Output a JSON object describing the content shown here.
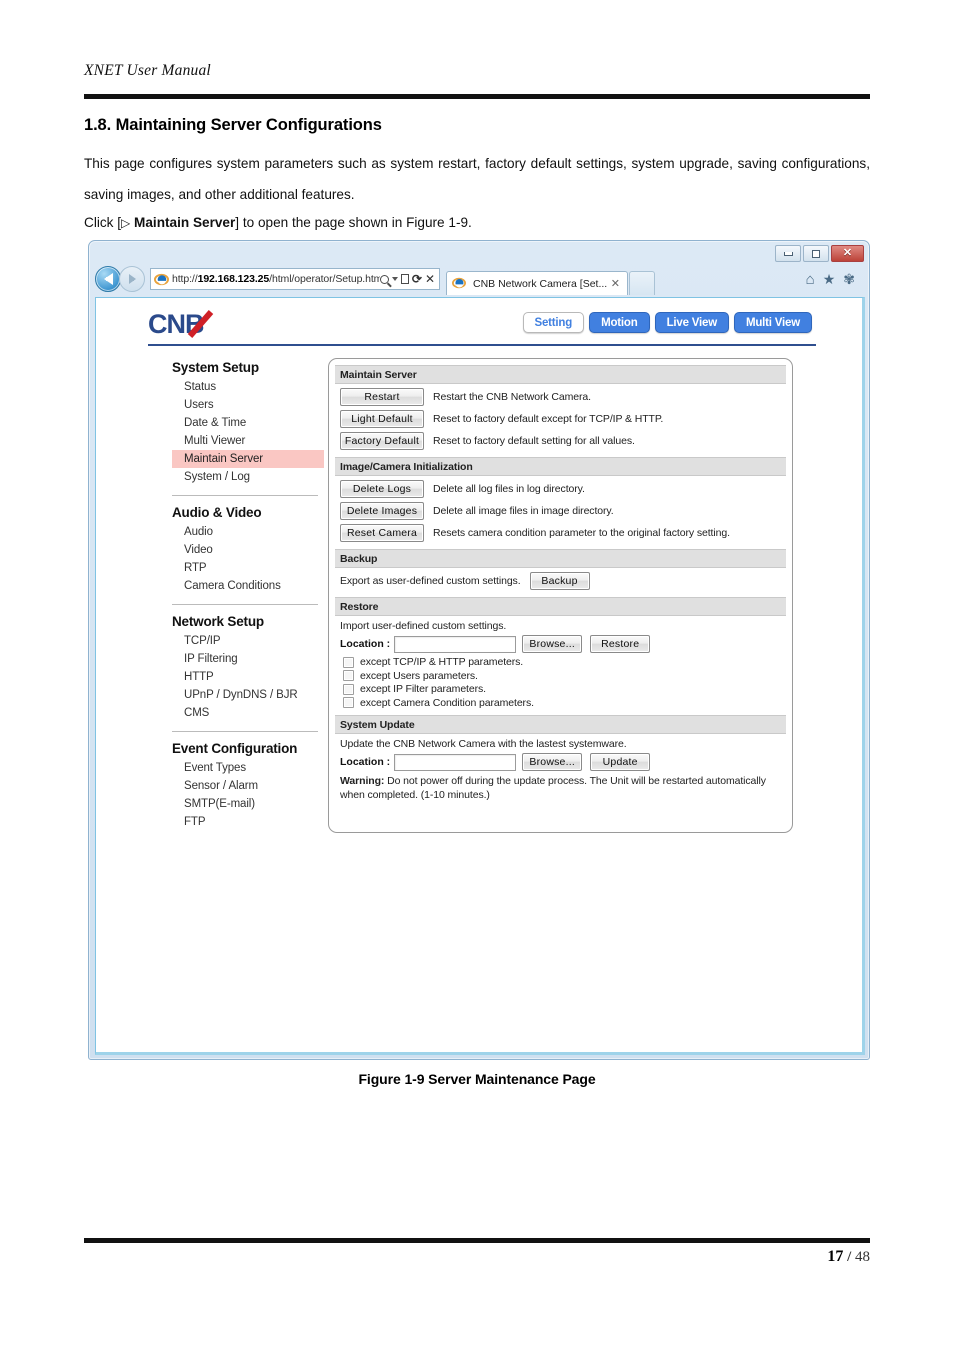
{
  "document": {
    "running_header": "XNET User Manual",
    "section_title": "1.8. Maintaining Server Configurations",
    "paragraph_1": "This page configures system parameters such as system restart, factory default settings, system upgrade, saving configurations, saving images, and other additional features.",
    "click_prefix": "Click [",
    "click_triangle": "▷",
    "click_bold": "Maintain Server",
    "click_suffix": "] to open the page shown in Figure 1-9.",
    "figure_caption": "Figure 1-9 Server Maintenance Page",
    "page_current": "17",
    "page_separator": "/",
    "page_total": "48"
  },
  "browser": {
    "url_plain_prefix": "http://",
    "url_host": "192.168.123.25",
    "url_path": "/html/operator/Setup.html?st",
    "tab_title": "CNB Network Camera [Set...",
    "tab_close": "✕",
    "icons": {
      "back": "back-arrow-icon",
      "forward": "forward-arrow-icon",
      "ie_logo": "internet-explorer-icon",
      "search": "magnifier-icon",
      "dropdown": "caret-down-icon",
      "compat_view": "compatibility-view-icon",
      "refresh": "refresh-icon",
      "stop": "stop-icon",
      "home": "home-icon",
      "favorites": "star-icon",
      "tools": "gear-icon",
      "minimize": "minimize-icon",
      "maximize": "maximize-icon",
      "close": "close-icon"
    },
    "glyphs": {
      "refresh": "⟳",
      "stop": "✕",
      "home": "⌂",
      "favorites": "★",
      "tools": "✾"
    }
  },
  "app": {
    "brand": "CNB",
    "nav_tabs": [
      {
        "label": "Setting",
        "active": true
      },
      {
        "label": "Motion",
        "active": false
      },
      {
        "label": "Live View",
        "active": false
      },
      {
        "label": "Multi View",
        "active": false
      }
    ],
    "accent_blue": "#4180e0",
    "highlight_pink": "#fac7c3",
    "sidebar": [
      {
        "heading": "System Setup",
        "items": [
          {
            "label": "Status",
            "active": false
          },
          {
            "label": "Users",
            "active": false
          },
          {
            "label": "Date & Time",
            "active": false
          },
          {
            "label": "Multi Viewer",
            "active": false
          },
          {
            "label": "Maintain Server",
            "active": true
          },
          {
            "label": "System / Log",
            "active": false
          }
        ]
      },
      {
        "heading": "Audio & Video",
        "items": [
          {
            "label": "Audio",
            "active": false
          },
          {
            "label": "Video",
            "active": false
          },
          {
            "label": "RTP",
            "active": false
          },
          {
            "label": "Camera Conditions",
            "active": false
          }
        ]
      },
      {
        "heading": "Network Setup",
        "items": [
          {
            "label": "TCP/IP",
            "active": false
          },
          {
            "label": "IP Filtering",
            "active": false
          },
          {
            "label": "HTTP",
            "active": false
          },
          {
            "label": "UPnP / DynDNS / BJR",
            "active": false
          },
          {
            "label": "CMS",
            "active": false
          }
        ]
      },
      {
        "heading": "Event Configuration",
        "items": [
          {
            "label": "Event Types",
            "active": false
          },
          {
            "label": "Sensor / Alarm",
            "active": false
          },
          {
            "label": "SMTP(E-mail)",
            "active": false
          },
          {
            "label": "FTP",
            "active": false
          }
        ]
      }
    ],
    "panel": {
      "maintain_server": {
        "title": "Maintain Server",
        "rows": [
          {
            "button": "Restart",
            "description": "Restart the CNB Network Camera."
          },
          {
            "button": "Light Default",
            "description": "Reset to factory default except for TCP/IP & HTTP."
          },
          {
            "button": "Factory Default",
            "description": "Reset to factory default setting for all values."
          }
        ]
      },
      "image_camera_init": {
        "title": "Image/Camera Initialization",
        "rows": [
          {
            "button": "Delete Logs",
            "description": "Delete all log files in log directory."
          },
          {
            "button": "Delete Images",
            "description": "Delete all image files in image directory."
          },
          {
            "button": "Reset Camera",
            "description": "Resets camera condition parameter to the original factory setting."
          }
        ]
      },
      "backup": {
        "title": "Backup",
        "lead": "Export as user-defined custom settings.",
        "button": "Backup"
      },
      "restore": {
        "title": "Restore",
        "lead": "Import user-defined custom settings.",
        "location_label": "Location :",
        "location_value": "",
        "browse_button": "Browse...",
        "restore_button": "Restore",
        "checkboxes": [
          {
            "label": "except TCP/IP & HTTP parameters.",
            "checked": false
          },
          {
            "label": "except Users parameters.",
            "checked": false
          },
          {
            "label": "except IP Filter parameters.",
            "checked": false
          },
          {
            "label": "except Camera Condition parameters.",
            "checked": false
          }
        ]
      },
      "system_update": {
        "title": "System Update",
        "lead": "Update the CNB Network Camera with the lastest systemware.",
        "location_label": "Location :",
        "location_value": "",
        "browse_button": "Browse...",
        "update_button": "Update",
        "warning_label": "Warning:",
        "warning_text": "Do not power off during the update process. The Unit will be restarted automatically when completed. (1-10 minutes.)"
      }
    }
  }
}
